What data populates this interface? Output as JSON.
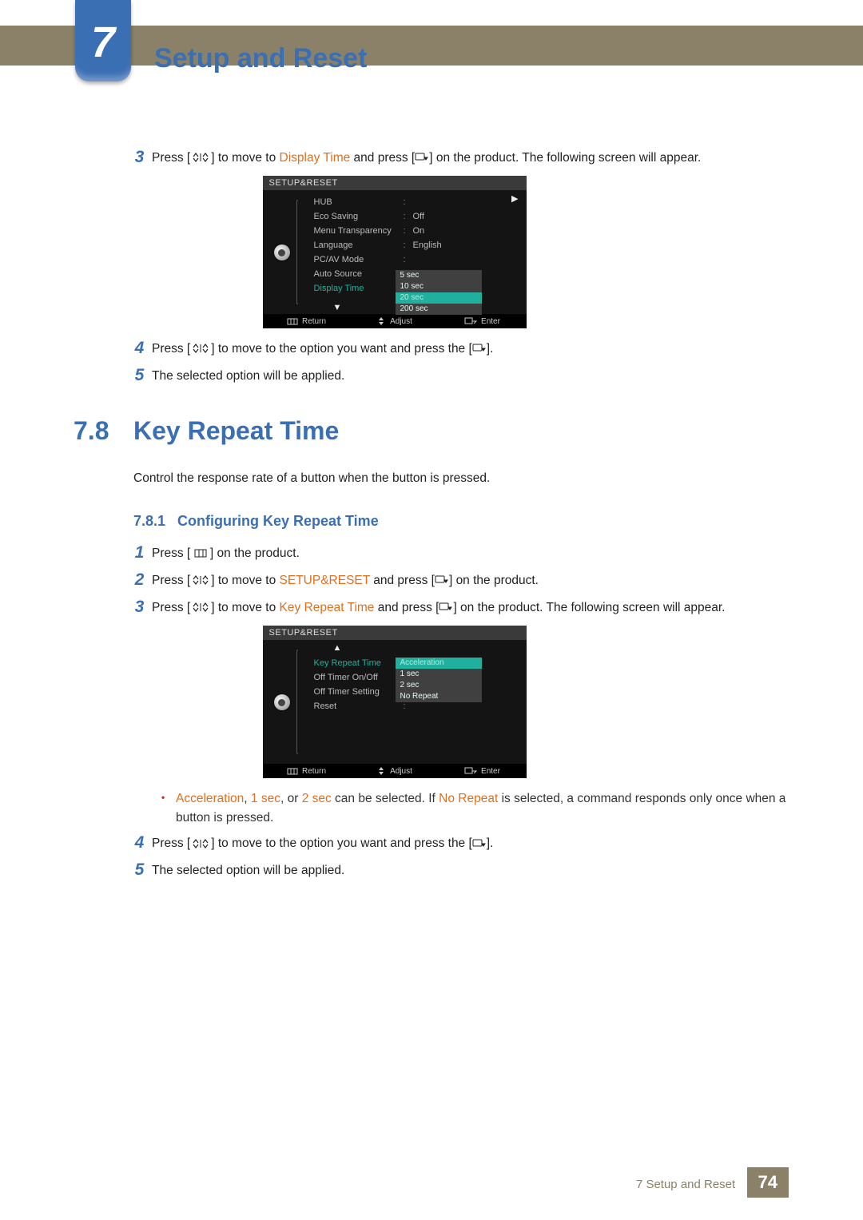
{
  "chapter": {
    "number": "7",
    "title": "Setup and Reset"
  },
  "icons": {
    "updown": "˄/˅",
    "menu": "menu-icon",
    "source": "source-icon"
  },
  "stepsA": {
    "3": {
      "pre": "Press [",
      "mid1": "] to move to ",
      "hl": "Display Time",
      "mid2": " and press [",
      "post": "] on the product. The following screen will appear."
    },
    "4": {
      "pre": "Press [",
      "mid": "] to move to the option you want and press the [",
      "post": "]."
    },
    "5": "The selected option will be applied."
  },
  "osd1": {
    "title": "SETUP&RESET",
    "items": [
      {
        "label": "HUB",
        "value": ""
      },
      {
        "label": "Eco Saving",
        "value": "Off"
      },
      {
        "label": "Menu Transparency",
        "value": "On"
      },
      {
        "label": "Language",
        "value": "English"
      },
      {
        "label": "PC/AV Mode",
        "value": ""
      },
      {
        "label": "Auto Source",
        "value": ""
      },
      {
        "label": "Display Time",
        "value": "",
        "selected": true
      }
    ],
    "dropdown": [
      "5 sec",
      "10 sec",
      "20 sec",
      "200 sec"
    ],
    "ddSelectedIndex": 2,
    "footer": {
      "return": "Return",
      "adjust": "Adjust",
      "enter": "Enter"
    }
  },
  "section78": {
    "num": "7.8",
    "title": "Key Repeat Time",
    "intro": "Control the response rate of a button when the button is pressed.",
    "sub": {
      "num": "7.8.1",
      "title": "Configuring Key Repeat Time"
    }
  },
  "stepsB": {
    "1": {
      "pre": "Press [ ",
      "post": " ] on the product."
    },
    "2": {
      "pre": "Press [",
      "mid1": "] to move to ",
      "hl": "SETUP&RESET",
      "mid2": " and press [",
      "post": "] on the product."
    },
    "3": {
      "pre": "Press [",
      "mid1": "] to move to ",
      "hl": "Key Repeat Time",
      "mid2": " and press [",
      "post": "] on the product. The following screen will appear."
    },
    "4": {
      "pre": "Press [",
      "mid": "] to move to the option you want and press the [",
      "post": "]."
    },
    "5": "The selected option will be applied."
  },
  "bullet": {
    "w1": "Acceleration",
    "s1": ", ",
    "w2": "1 sec",
    "s2": ", or ",
    "w3": "2 sec",
    "s3": " can be selected. If ",
    "w4": "No Repeat",
    "s4": " is selected, a command responds only once when a button is pressed."
  },
  "osd2": {
    "title": "SETUP&RESET",
    "items": [
      {
        "label": "Key Repeat Time",
        "value": "",
        "selected": true
      },
      {
        "label": "Off Timer On/Off",
        "value": ""
      },
      {
        "label": "Off Timer Setting",
        "value": ""
      },
      {
        "label": "Reset",
        "value": ""
      }
    ],
    "dropdown": [
      "Acceleration",
      "1 sec",
      "2 sec",
      "No Repeat"
    ],
    "ddSelectedIndex": 0,
    "footer": {
      "return": "Return",
      "adjust": "Adjust",
      "enter": "Enter"
    }
  },
  "footer": {
    "label": "7 Setup and Reset",
    "page": "74"
  }
}
